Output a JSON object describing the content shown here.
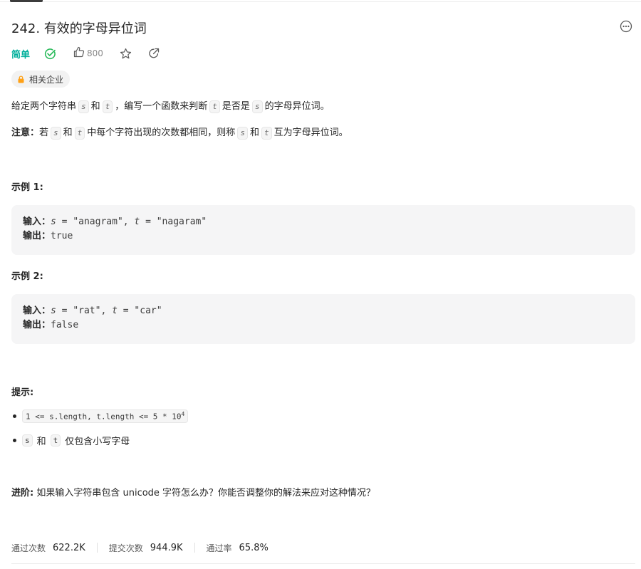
{
  "problem": {
    "title": "242. 有效的字母异位词",
    "difficulty": "简单",
    "likes": "800",
    "company_tag": "相关企业"
  },
  "description": {
    "p1": [
      "给定两个字符串",
      "s",
      "和",
      "t",
      "，编写一个函数来判断",
      "t",
      "是否是",
      "s",
      "的字母异位词。"
    ],
    "note_label": "注意：",
    "note": [
      "若",
      "s",
      "和",
      "t",
      "中每个字符出现的次数都相同，则称",
      "s",
      "和",
      "t",
      "互为字母异位词。"
    ]
  },
  "examples": [
    {
      "title": "示例 1:",
      "input_label": "输入：",
      "input": [
        "s",
        " = \"anagram\", ",
        "t",
        " = \"nagaram\""
      ],
      "output_label": "输出：",
      "output": "true"
    },
    {
      "title": "示例 2:",
      "input_label": "输入：",
      "input": [
        "s",
        " = \"rat\", ",
        "t",
        " = \"car\""
      ],
      "output_label": "输出：",
      "output": "false"
    }
  ],
  "hints": {
    "title": "提示:",
    "items": [
      {
        "code": "1 <= s.length, t.length <= 5 * 10",
        "sup": "4"
      },
      {
        "parts": [
          "s",
          "和",
          "t",
          "仅包含小写字母"
        ]
      }
    ]
  },
  "followup": {
    "label": "进阶:",
    "text": "如果输入字符串包含 unicode 字符怎么办？你能否调整你的解法来应对这种情况？"
  },
  "stats": [
    {
      "label": "通过次数",
      "value": "622.2K"
    },
    {
      "label": "提交次数",
      "value": "944.9K"
    },
    {
      "label": "通过率",
      "value": "65.8%"
    }
  ],
  "colors": {
    "easy": "#00af9b",
    "accepted_check": "#2cbb5d",
    "lock": "#ffa116"
  },
  "icons": {
    "more": "more-horizontal-circle-icon",
    "solved": "check-circle-icon",
    "like": "thumbs-up-icon",
    "favorite": "star-icon",
    "share": "share-icon",
    "lock": "lock-icon"
  }
}
